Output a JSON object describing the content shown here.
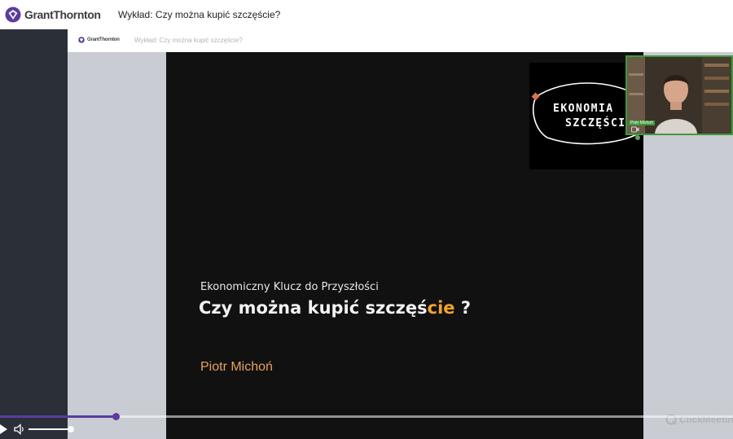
{
  "header": {
    "brand": "GrantThornton",
    "title": "Wykład: Czy można kupić szczęście?"
  },
  "recording_header": {
    "brand": "GrantThornton",
    "title": "Wykład: Czy można kupić szczęście?"
  },
  "slide": {
    "subtitle": "Ekonomiczny Klucz do Przyszłości",
    "title_main": "Czy można kupić szczęś",
    "title_accent": "cie",
    "title_end": " ?",
    "author": "Piotr Michoń",
    "badge": {
      "line1": "EKONOMIA",
      "line2": "SZCZĘŚCIA"
    }
  },
  "webcam": {
    "name": "Piotr Michoń"
  },
  "watermark": {
    "text": "ClickMeeting"
  },
  "player": {
    "progress": 0.158,
    "volume": 1.0
  },
  "colors": {
    "brand": "#5b3c9c",
    "accent": "#f2a52c",
    "author": "#e7a25c",
    "cam_border": "#3f9a3a"
  },
  "icons": {
    "brand": "grant-thornton-logo-icon",
    "play": "play-icon",
    "volume": "volume-icon",
    "camera": "camera-icon",
    "watermark": "clickmeeting-logo-icon"
  }
}
